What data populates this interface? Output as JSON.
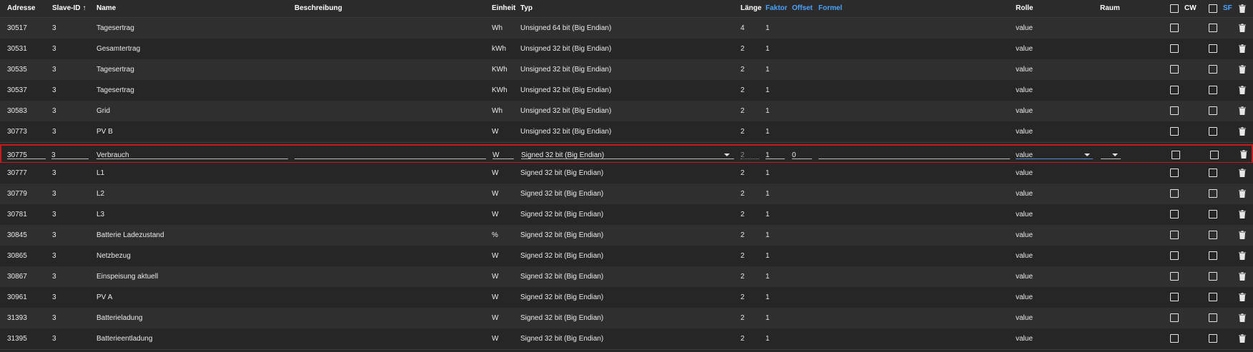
{
  "headers": {
    "adresse": "Adresse",
    "slave_id": "Slave-ID",
    "name": "Name",
    "beschreibung": "Beschreibung",
    "einheit": "Einheit",
    "typ": "Typ",
    "laenge": "Länge",
    "faktor": "Faktor",
    "offset": "Offset",
    "formel": "Formel",
    "rolle": "Rolle",
    "raum": "Raum",
    "cw": "CW",
    "sf": "SF",
    "sort_indicator": "↑"
  },
  "colors": {
    "accent_blue": "#4aa3ff",
    "selection_red": "#c8191c"
  },
  "icons": {
    "delete": "trash-icon",
    "sort": "arrow-up-icon",
    "select": "chevron-down-icon"
  },
  "rows": [
    {
      "adresse": "30517",
      "slave": "3",
      "name": "Tagesertrag",
      "einheit": "Wh",
      "typ": "Unsigned 64 bit (Big Endian)",
      "laenge": "4",
      "faktor": "1",
      "rolle": "value"
    },
    {
      "adresse": "30531",
      "slave": "3",
      "name": "Gesamtertrag",
      "einheit": "kWh",
      "typ": "Unsigned 32 bit (Big Endian)",
      "laenge": "2",
      "faktor": "1",
      "rolle": "value"
    },
    {
      "adresse": "30535",
      "slave": "3",
      "name": "Tagesertrag",
      "einheit": "KWh",
      "typ": "Unsigned 32 bit (Big Endian)",
      "laenge": "2",
      "faktor": "1",
      "rolle": "value"
    },
    {
      "adresse": "30537",
      "slave": "3",
      "name": "Tagesertrag",
      "einheit": "KWh",
      "typ": "Unsigned 32 bit (Big Endian)",
      "laenge": "2",
      "faktor": "1",
      "rolle": "value"
    },
    {
      "adresse": "30583",
      "slave": "3",
      "name": "Grid",
      "einheit": "Wh",
      "typ": "Unsigned 32 bit (Big Endian)",
      "laenge": "2",
      "faktor": "1",
      "rolle": "value"
    },
    {
      "adresse": "30773",
      "slave": "3",
      "name": "PV B",
      "einheit": "W",
      "typ": "Unsigned 32 bit (Big Endian)",
      "laenge": "2",
      "faktor": "1",
      "rolle": "value"
    },
    {
      "adresse": "30775",
      "slave": "3",
      "name": "Verbrauch",
      "einheit": "W",
      "typ": "Signed 32 bit (Big Endian)",
      "laenge": "2",
      "faktor": "1",
      "offset": "0",
      "rolle": "value",
      "editing": true
    },
    {
      "adresse": "30777",
      "slave": "3",
      "name": "L1",
      "einheit": "W",
      "typ": "Signed 32 bit (Big Endian)",
      "laenge": "2",
      "faktor": "1",
      "rolle": "value"
    },
    {
      "adresse": "30779",
      "slave": "3",
      "name": "L2",
      "einheit": "W",
      "typ": "Signed 32 bit (Big Endian)",
      "laenge": "2",
      "faktor": "1",
      "rolle": "value"
    },
    {
      "adresse": "30781",
      "slave": "3",
      "name": "L3",
      "einheit": "W",
      "typ": "Signed 32 bit (Big Endian)",
      "laenge": "2",
      "faktor": "1",
      "rolle": "value"
    },
    {
      "adresse": "30845",
      "slave": "3",
      "name": "Batterie Ladezustand",
      "einheit": "%",
      "typ": "Signed 32 bit (Big Endian)",
      "laenge": "2",
      "faktor": "1",
      "rolle": "value"
    },
    {
      "adresse": "30865",
      "slave": "3",
      "name": "Netzbezug",
      "einheit": "W",
      "typ": "Signed 32 bit (Big Endian)",
      "laenge": "2",
      "faktor": "1",
      "rolle": "value"
    },
    {
      "adresse": "30867",
      "slave": "3",
      "name": "Einspeisung aktuell",
      "einheit": "W",
      "typ": "Signed 32 bit (Big Endian)",
      "laenge": "2",
      "faktor": "1",
      "rolle": "value"
    },
    {
      "adresse": "30961",
      "slave": "3",
      "name": "PV A",
      "einheit": "W",
      "typ": "Signed 32 bit (Big Endian)",
      "laenge": "2",
      "faktor": "1",
      "rolle": "value"
    },
    {
      "adresse": "31393",
      "slave": "3",
      "name": "Batterieladung",
      "einheit": "W",
      "typ": "Signed 32 bit (Big Endian)",
      "laenge": "2",
      "faktor": "1",
      "rolle": "value"
    },
    {
      "adresse": "31395",
      "slave": "3",
      "name": "Batterieentladung",
      "einheit": "W",
      "typ": "Signed 32 bit (Big Endian)",
      "laenge": "2",
      "faktor": "1",
      "rolle": "value"
    }
  ]
}
